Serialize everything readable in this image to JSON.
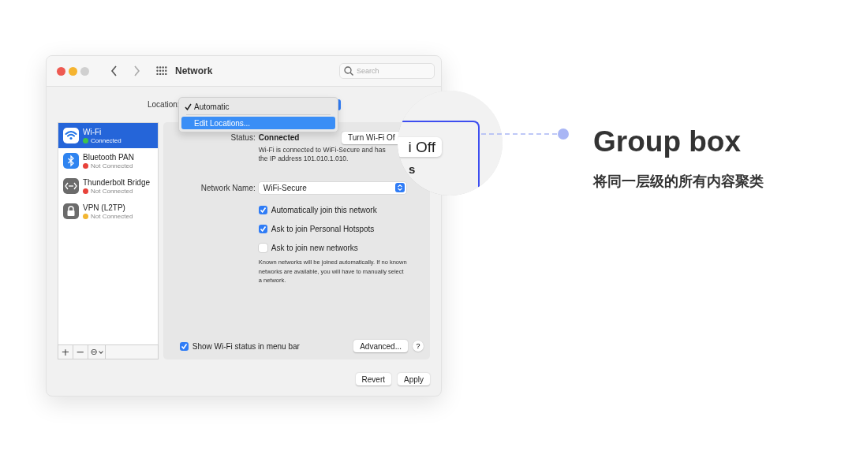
{
  "window": {
    "title": "Network"
  },
  "search": {
    "placeholder": "Search"
  },
  "location": {
    "label": "Location:",
    "menu": [
      {
        "label": "Automatic",
        "checked": true,
        "selected": false
      },
      {
        "label": "Edit Locations...",
        "checked": false,
        "selected": true
      }
    ]
  },
  "services": [
    {
      "kind": "wifi",
      "name": "Wi-Fi",
      "status": "Connected",
      "color": "#3fc34a",
      "selected": true
    },
    {
      "kind": "bluetooth",
      "name": "Bluetooth PAN",
      "status": "Not Connected",
      "color": "#e8423a",
      "selected": false
    },
    {
      "kind": "bridge",
      "name": "Thunderbolt Bridge",
      "status": "Not Connected",
      "color": "#e8423a",
      "selected": false
    },
    {
      "kind": "vpn",
      "name": "VPN (L2TP)",
      "status": "Not Connected",
      "color": "#f2b632",
      "selected": false
    }
  ],
  "service_toolbar": {
    "add": "+",
    "remove": "−",
    "action": "⊖"
  },
  "status": {
    "label": "Status:",
    "value": "Connected",
    "button": "Turn Wi-Fi Of",
    "description": "Wi-Fi is connected to WiFi-Secure and has the IP address 101.010.1.010."
  },
  "network_name": {
    "label": "Network Name:",
    "value": "WiFi-Secure"
  },
  "options": [
    {
      "label": "Automatically join this network",
      "checked": true
    },
    {
      "label": "Ask to join Personal Hotspots",
      "checked": true
    },
    {
      "label": "Ask to join new networks",
      "checked": false
    }
  ],
  "note": "Known networks will be joined automatically. If no known networks are available, you will have to manually select a network.",
  "menu_bar_option": {
    "label": "Show Wi-Fi status in menu bar",
    "checked": true
  },
  "advanced_button": "Advanced...",
  "help": "?",
  "buttons": [
    "Revert",
    "Apply"
  ],
  "magnifier": {
    "button": "i Off",
    "text": "s"
  },
  "annotation": {
    "title": "Group box",
    "subtitle": "将同一层级的所有内容聚类"
  }
}
